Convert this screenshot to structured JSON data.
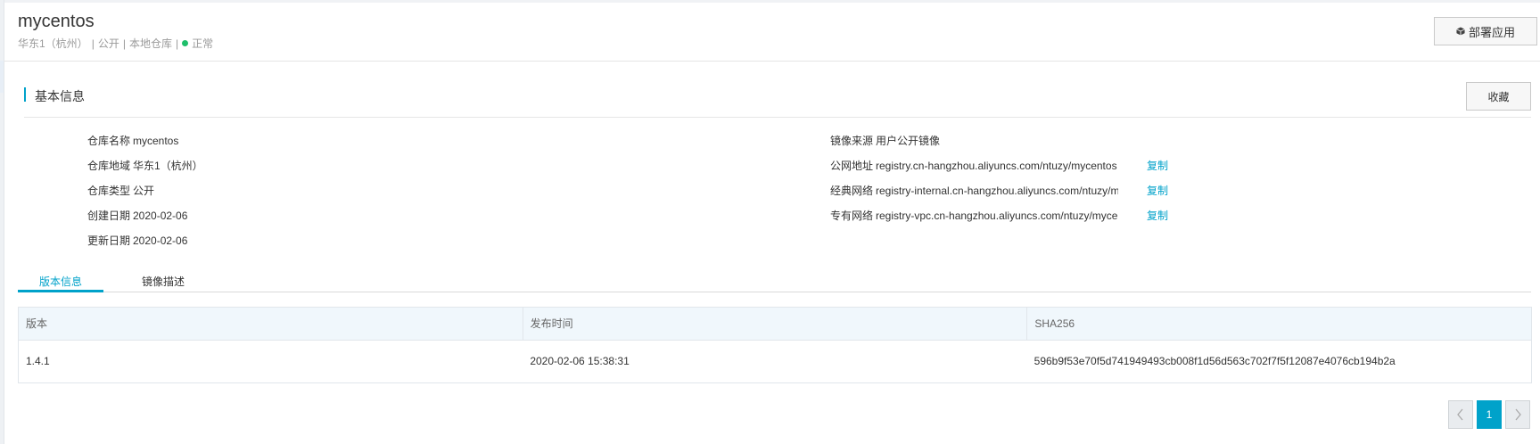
{
  "header": {
    "title": "mycentos",
    "region": "华东1（杭州）",
    "visibility": "公开",
    "repo_type": "本地仓库",
    "status": "正常",
    "status_color": "#1fbf6b",
    "deploy_label": "部署应用"
  },
  "basic_info": {
    "title": "基本信息",
    "favorite_label": "收藏",
    "left": [
      {
        "label": "仓库名称",
        "value": "mycentos"
      },
      {
        "label": "仓库地域",
        "value": "华东1（杭州）"
      },
      {
        "label": "仓库类型",
        "value": "公开"
      },
      {
        "label": "创建日期",
        "value": "2020-02-06"
      },
      {
        "label": "更新日期",
        "value": "2020-02-06"
      }
    ],
    "right": [
      {
        "label": "镜像来源",
        "value": "用户公开镜像"
      },
      {
        "label": "公网地址",
        "value": "registry.cn-hangzhou.aliyuncs.com/ntuzy/mycentos",
        "action": "复制"
      },
      {
        "label": "经典网络",
        "value": "registry-internal.cn-hangzhou.aliyuncs.com/ntuzy/mycentos",
        "action": "复制"
      },
      {
        "label": "专有网络",
        "value": "registry-vpc.cn-hangzhou.aliyuncs.com/ntuzy/mycentos",
        "action": "复制"
      }
    ]
  },
  "tabs": [
    {
      "label": "版本信息",
      "active": true
    },
    {
      "label": "镜像描述",
      "active": false
    }
  ],
  "table": {
    "columns": [
      "版本",
      "发布时间",
      "SHA256"
    ],
    "rows": [
      [
        "1.4.1",
        "2020-02-06 15:38:31",
        "596b9f53e70f5d741949493cb008f1d56d563c702f7f5f12087e4076cb194b2a"
      ]
    ]
  },
  "pagination": {
    "prev_icon": "chevron-left-icon",
    "current_page": "1",
    "next_icon": "chevron-right-icon"
  },
  "colors": {
    "accent": "#00a2ca",
    "status_ok": "#1fbf6b"
  }
}
